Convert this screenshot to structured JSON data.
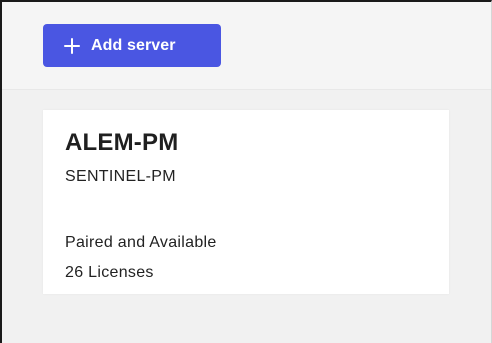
{
  "toolbar": {
    "add_server_label": "Add server",
    "add_icon": "plus-icon",
    "accent_color": "#4a56e2"
  },
  "servers": [
    {
      "name": "ALEM-PM",
      "subtitle": "SENTINEL-PM",
      "status": "Paired and Available",
      "licenses": "26 Licenses"
    }
  ]
}
